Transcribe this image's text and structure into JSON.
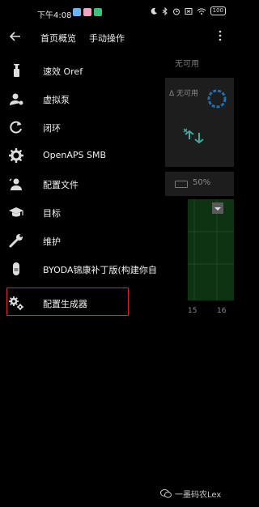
{
  "status_bar": {
    "time": "下午4:08",
    "battery": "100"
  },
  "tabs": [
    {
      "label": "首页概览"
    },
    {
      "label": "手动操作"
    }
  ],
  "background": {
    "unavailable_top": "无可用",
    "delta_unavailable": "Δ 无可用",
    "battery_pct": "50%",
    "axis_15": "15",
    "axis_16": "16",
    "colors": {
      "chart_bg": "#0e3312",
      "accent": "#4fc3c3"
    }
  },
  "menu": {
    "items": [
      {
        "label": "速效 Oref",
        "icon": "insulin-pen-icon"
      },
      {
        "label": "虚拟泵",
        "icon": "virtual-pump-icon"
      },
      {
        "label": "闭环",
        "icon": "loop-icon"
      },
      {
        "label": "OpenAPS SMB",
        "icon": "gear-icon"
      },
      {
        "label": "配置文件",
        "icon": "profile-icon"
      },
      {
        "label": "目标",
        "icon": "graduation-cap-icon"
      },
      {
        "label": "维护",
        "icon": "wrench-icon"
      },
      {
        "label": "BYODA锦康补丁版(构建你自",
        "icon": "byoda-icon"
      },
      {
        "label": "配置生成器",
        "icon": "config-builder-icon"
      }
    ],
    "highlighted_index": 8,
    "highlight_color": "#d9262b"
  },
  "watermark": {
    "text": "一墨码农Lex"
  }
}
